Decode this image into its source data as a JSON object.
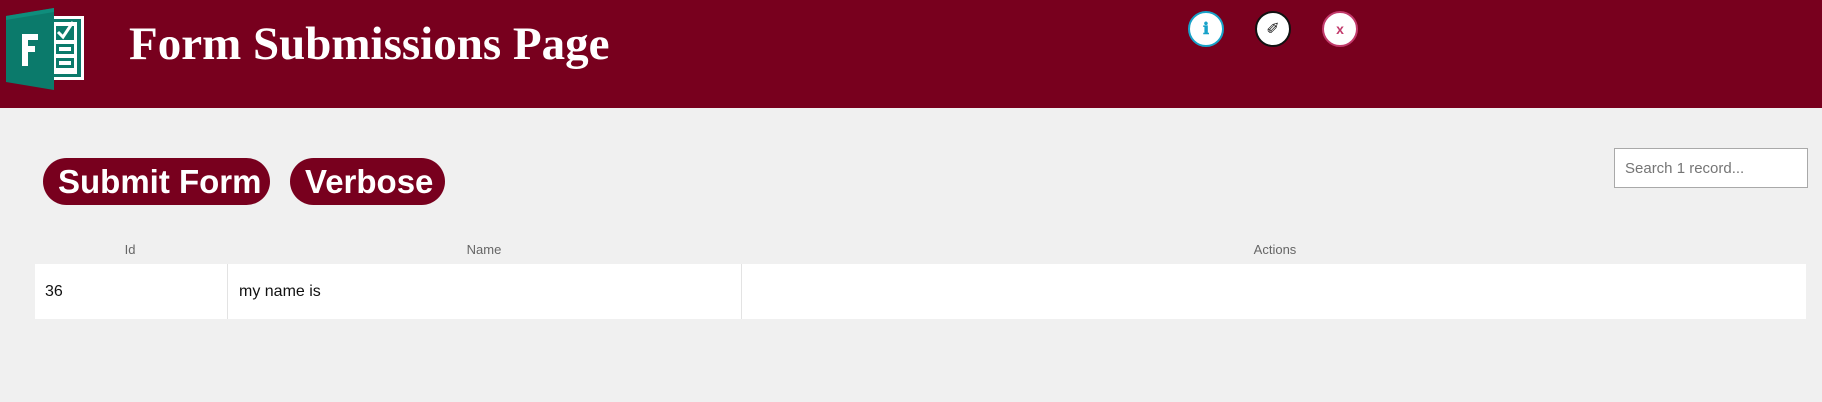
{
  "header": {
    "title": "Form Submissions Page",
    "logo_icon": "microsoft-forms-logo",
    "background_color": "#78001e"
  },
  "toolbar": {
    "submit_label": "Submit Form",
    "verbose_label": "Verbose"
  },
  "search": {
    "placeholder": "Search 1 record..."
  },
  "table": {
    "columns": [
      "Id",
      "Name",
      "Actions"
    ],
    "rows": [
      {
        "id": "36",
        "name": "my name is"
      }
    ],
    "actions": [
      {
        "name": "info",
        "glyph": "ℹ",
        "color": "#17a2c9"
      },
      {
        "name": "edit",
        "glyph": "✐",
        "color": "#111111"
      },
      {
        "name": "delete",
        "glyph": "x",
        "color": "#c23a6b"
      }
    ]
  }
}
